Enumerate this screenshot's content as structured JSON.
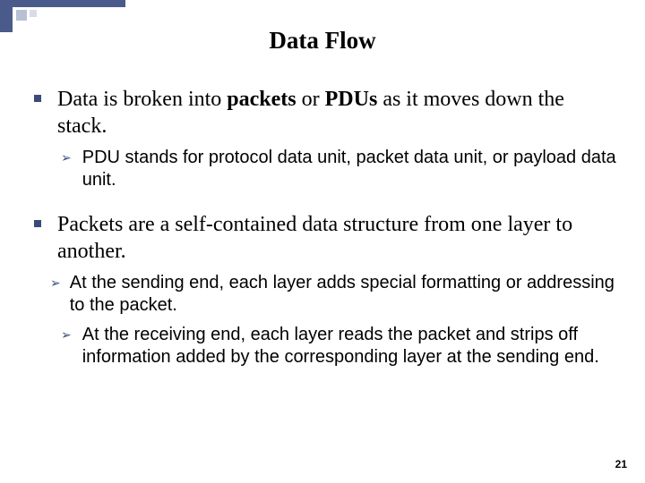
{
  "title": "Data Flow",
  "bullets": {
    "b1": {
      "pre": "Data is broken into ",
      "strong1": "packets",
      "mid": " or ",
      "strong2": "PDUs",
      "post": " as it moves down the stack."
    },
    "b1_sub1": "PDU stands for protocol data unit, packet data unit, or payload data unit.",
    "b2": "Packets are a self-contained data structure from one layer to another.",
    "b2_sub1": "At the sending end, each layer adds special formatting or addressing to the packet.",
    "b2_sub2": "At the receiving end, each layer reads the packet and strips off information added by the corresponding layer at the sending end."
  },
  "page_number": "21",
  "glyphs": {
    "arrow": "➢"
  }
}
